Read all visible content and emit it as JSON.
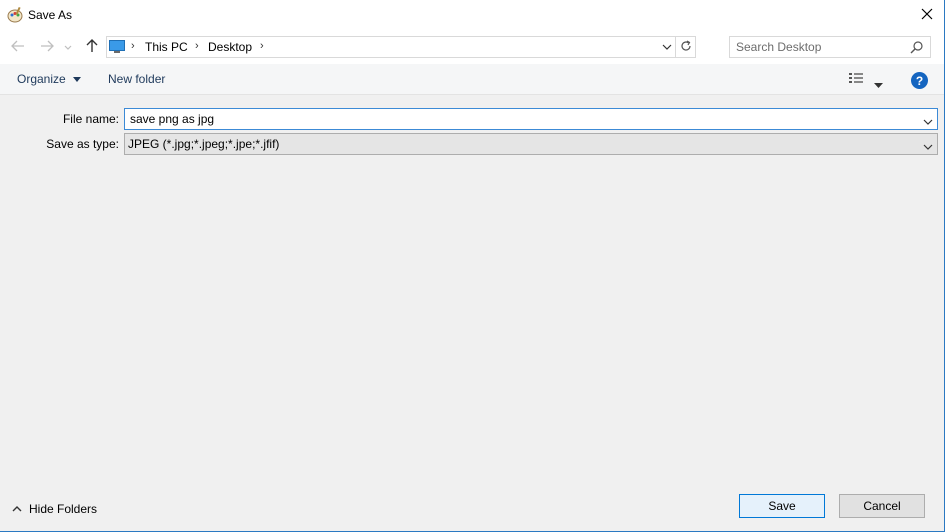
{
  "window": {
    "title": "Save As"
  },
  "icons": {
    "app": "paint-icon",
    "close": "close-icon",
    "back": "arrow-left-icon",
    "forward": "arrow-right-icon",
    "recent": "chevron-down-icon",
    "up": "arrow-up-icon",
    "pc": "computer-icon",
    "refresh": "refresh-icon",
    "search": "search-icon",
    "view": "details-view-icon",
    "help": "help-icon"
  },
  "address": {
    "breadcrumbs": [
      "This PC",
      "Desktop"
    ]
  },
  "search": {
    "placeholder": "Search Desktop"
  },
  "toolbar": {
    "organize_label": "Organize",
    "new_folder_label": "New folder",
    "help_glyph": "?"
  },
  "form": {
    "file_name_label": "File name:",
    "file_name_value": "save png as jpg",
    "save_type_label": "Save as type:",
    "save_type_value": "JPEG (*.jpg;*.jpeg;*.jpe;*.jfif)"
  },
  "footer": {
    "hide_folders_label": "Hide Folders",
    "save_label": "Save",
    "cancel_label": "Cancel"
  },
  "colors": {
    "accent": "#0078d7",
    "help_bg": "#1565c0",
    "focus_border": "#3c8ad6"
  }
}
